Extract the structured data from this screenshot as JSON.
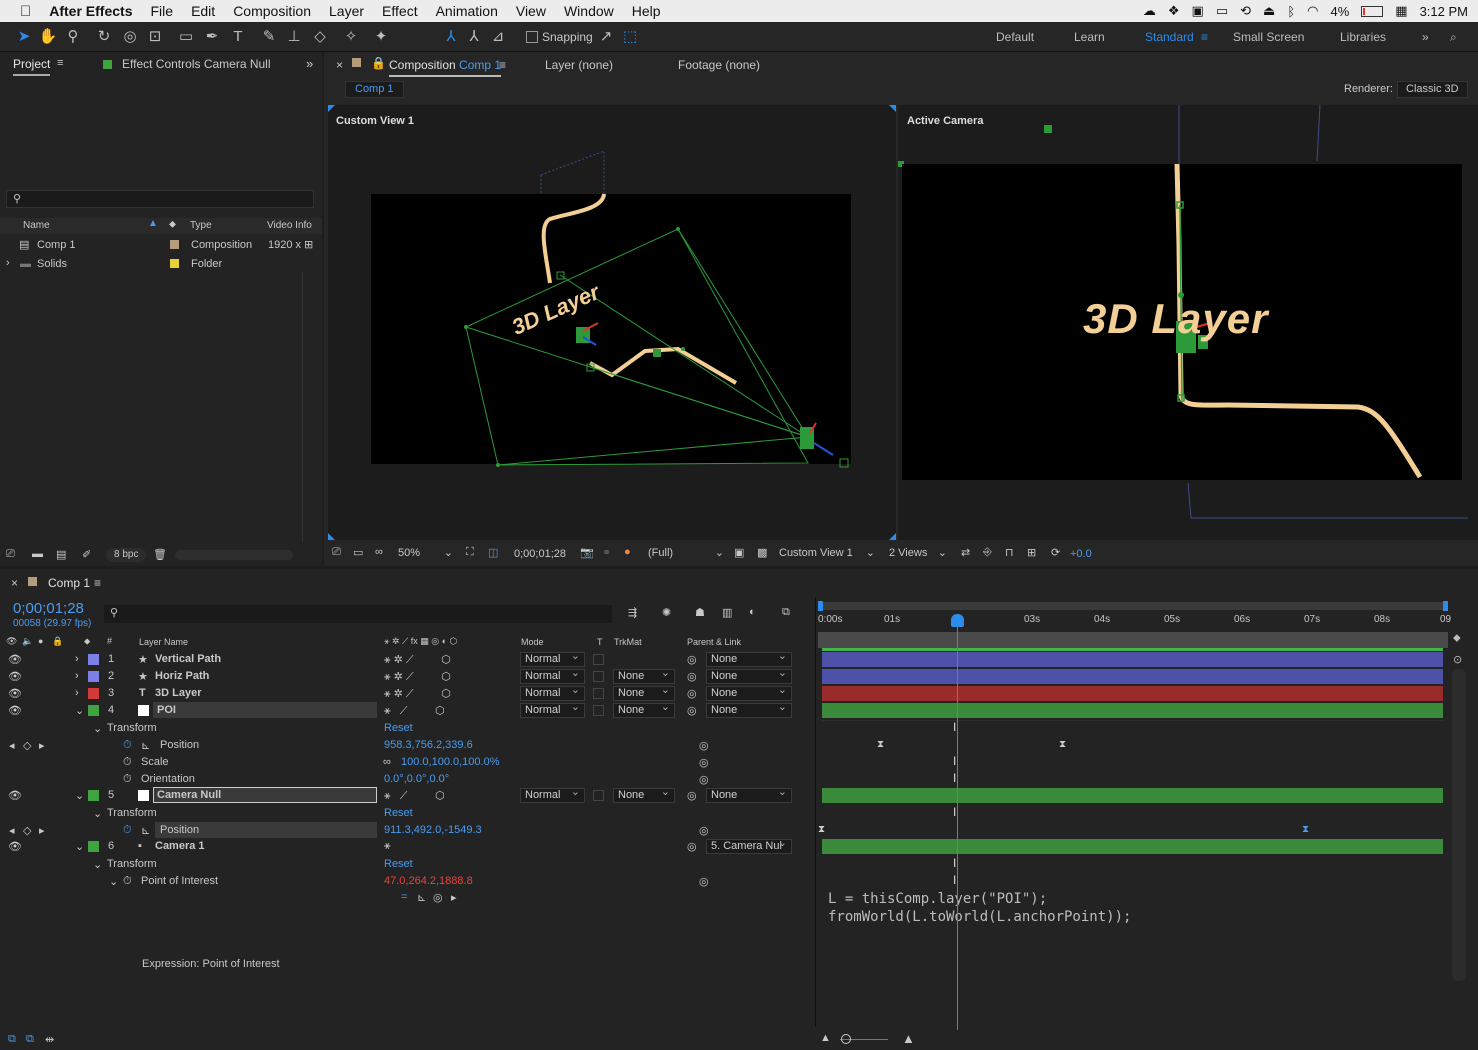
{
  "menubar": {
    "app": "After Effects",
    "items": [
      "File",
      "Edit",
      "Composition",
      "Layer",
      "Effect",
      "Animation",
      "View",
      "Window",
      "Help"
    ],
    "battery": "4%",
    "clock": "3:12 PM"
  },
  "toolbar": {
    "snapping": "Snapping",
    "workspaces": [
      "Default",
      "Learn",
      "Standard",
      "Small Screen",
      "Libraries"
    ],
    "active_workspace": "Standard"
  },
  "project": {
    "tab": "Project",
    "effect_tab": "Effect Controls Camera Null",
    "search_placeholder": "",
    "columns": [
      "Name",
      "Type",
      "Video Info"
    ],
    "items": [
      {
        "name": "Comp 1",
        "type": "Composition",
        "info": "1920 x",
        "color": "#b59c7a"
      },
      {
        "name": "Solids",
        "type": "Folder",
        "info": "",
        "color": "#e8d03a"
      }
    ],
    "bpc": "8 bpc"
  },
  "composition": {
    "tab_prefix": "Composition",
    "tab_name": "Comp 1",
    "layer_tab": "Layer (none)",
    "footage_tab": "Footage (none)",
    "breadcrumb": "Comp 1",
    "renderer_label": "Renderer:",
    "renderer": "Classic 3D",
    "left_view": "Custom View 1",
    "right_view": "Active Camera",
    "text_3d": "3D Layer",
    "zoom": "50%",
    "timecode": "0;00;01;28",
    "resolution": "(Full)",
    "view_select": "Custom View 1",
    "views_select": "2 Views",
    "exposure": "+0.0"
  },
  "timeline": {
    "tab": "Comp 1",
    "timecode": "0;00;01;28",
    "frames": "00058 (29.97 fps)",
    "col_layer_name": "Layer Name",
    "col_mode": "Mode",
    "col_t": "T",
    "col_trkmat": "TrkMat",
    "col_parent": "Parent & Link",
    "ruler": [
      "0:00s",
      "01s",
      "03s",
      "04s",
      "05s",
      "06s",
      "07s",
      "08s",
      "09"
    ],
    "layers": [
      {
        "num": "1",
        "name": "Vertical Path",
        "mode": "Normal",
        "trk": "",
        "parent": "None",
        "color": "#7b7fe6"
      },
      {
        "num": "2",
        "name": "Horiz Path",
        "mode": "Normal",
        "trk": "None",
        "parent": "None",
        "color": "#7b7fe6"
      },
      {
        "num": "3",
        "name": "3D Layer",
        "mode": "Normal",
        "trk": "None",
        "parent": "None",
        "color": "#d23a3a"
      },
      {
        "num": "4",
        "name": "POI",
        "mode": "Normal",
        "trk": "None",
        "parent": "None",
        "color": "#3fa33f"
      },
      {
        "num": "5",
        "name": "Camera Null",
        "mode": "Normal",
        "trk": "None",
        "parent": "None",
        "color": "#3fa33f"
      },
      {
        "num": "6",
        "name": "Camera 1",
        "parent": "5. Camera Nul",
        "color": "#3fa33f"
      }
    ],
    "transform": "Transform",
    "reset": "Reset",
    "poi_props": [
      {
        "name": "Position",
        "value": "958.3,756.2,339.6"
      },
      {
        "name": "Scale",
        "value": "100.0,100.0,100.0%"
      },
      {
        "name": "Orientation",
        "value": "0.0°,0.0°,0.0°"
      }
    ],
    "null_position": {
      "name": "Position",
      "value": "911.3,492.0,-1549.3"
    },
    "cam_poi": {
      "name": "Point of Interest",
      "value": "47.0,264.2,1888.8"
    },
    "expression_label": "Expression: Point of Interest",
    "expression_line1": "L = thisComp.layer(\"POI\");",
    "expression_line2": "fromWorld(L.toWorld(L.anchorPoint));"
  }
}
